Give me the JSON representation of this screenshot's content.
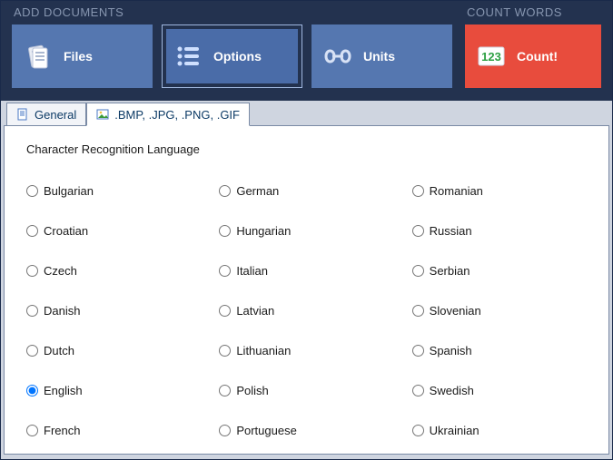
{
  "header": {
    "left_label": "ADD DOCUMENTS",
    "right_label": "COUNT WORDS",
    "buttons": {
      "files": "Files",
      "options": "Options",
      "units": "Units",
      "count": "Count!"
    }
  },
  "tabs": {
    "general": "General",
    "images": ".BMP, .JPG, .PNG, .GIF"
  },
  "panel": {
    "title": "Character Recognition Language"
  },
  "languages": {
    "selected": "English",
    "col1": [
      "Bulgarian",
      "Croatian",
      "Czech",
      "Danish",
      "Dutch",
      "English",
      "French"
    ],
    "col2": [
      "German",
      "Hungarian",
      "Italian",
      "Latvian",
      "Lithuanian",
      "Polish",
      "Portuguese"
    ],
    "col3": [
      "Romanian",
      "Russian",
      "Serbian",
      "Slovenian",
      "Spanish",
      "Swedish",
      "Ukrainian"
    ]
  }
}
